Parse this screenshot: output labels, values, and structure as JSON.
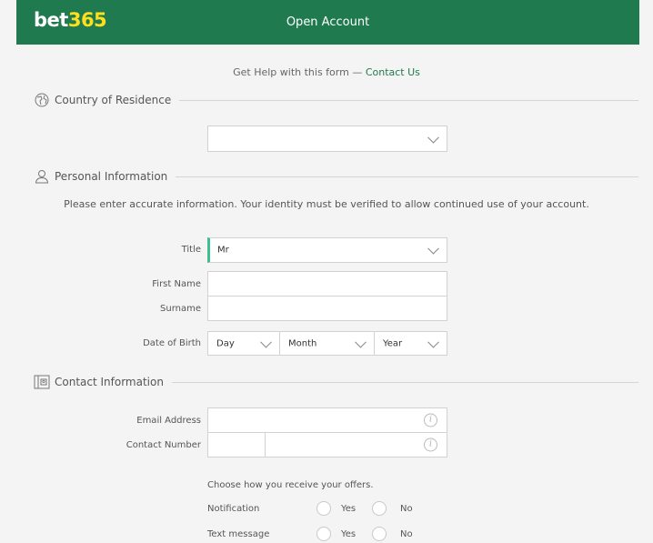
{
  "header": {
    "logo_part1": "bet",
    "logo_part2": "365",
    "title": "Open Account"
  },
  "help": {
    "text": "Get Help with this form — ",
    "link": "Contact Us"
  },
  "sections": {
    "country": "Country of Residence",
    "personal": "Personal Information",
    "contact": "Contact Information"
  },
  "country": {
    "selected": ""
  },
  "personal": {
    "notice": "Please enter accurate information. Your identity must be verified to allow continued use of your account.",
    "title_label": "Title",
    "title_value": "Mr",
    "first_name_label": "First Name",
    "surname_label": "Surname",
    "dob_label": "Date of Birth",
    "dob_day": "Day",
    "dob_month": "Month",
    "dob_year": "Year"
  },
  "contact": {
    "email_label": "Email Address",
    "phone_label": "Contact Number"
  },
  "offers": {
    "title": "Choose how you receive your offers.",
    "rows": [
      {
        "label": "Notification",
        "yes": "Yes",
        "no": "No"
      },
      {
        "label": "Text message",
        "yes": "Yes",
        "no": "No"
      }
    ]
  },
  "colors": {
    "brand_green": "#1f7a4f",
    "logo_yellow": "#ffdf1b",
    "accent_bar": "#3fbf8f"
  }
}
